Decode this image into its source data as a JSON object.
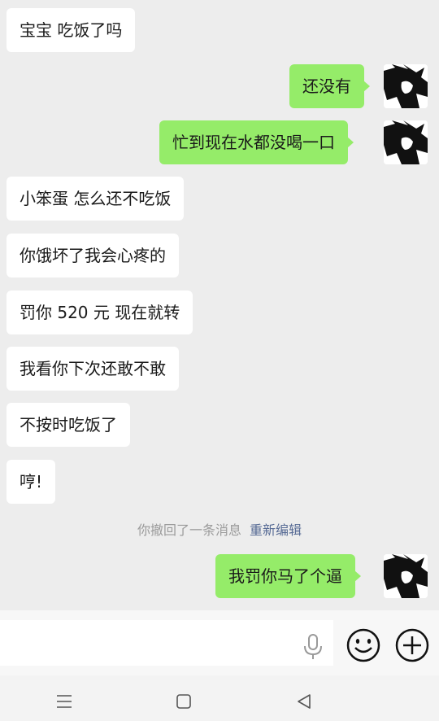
{
  "messages": [
    {
      "side": "left",
      "text": "宝宝  吃饭了吗"
    },
    {
      "side": "right",
      "text": "还没有"
    },
    {
      "side": "right",
      "text": "忙到现在水都没喝一口"
    },
    {
      "side": "left",
      "text": "小笨蛋  怎么还不吃饭"
    },
    {
      "side": "left",
      "text": "你饿坏了我会心疼的"
    },
    {
      "side": "left",
      "text": "罚你 520 元  现在就转"
    },
    {
      "side": "left",
      "text": "我看你下次还敢不敢"
    },
    {
      "side": "left",
      "text": "不按时吃饭了"
    },
    {
      "side": "left",
      "text": "哼!"
    },
    {
      "side": "right",
      "text": "我罚你马了个逼"
    }
  ],
  "recall_notice": {
    "text": "你撤回了一条消息",
    "action": "重新编辑"
  },
  "input_bar": {
    "value": "",
    "icons": [
      "microphone-icon",
      "emoji-icon",
      "plus-icon"
    ]
  },
  "nav_bar": {
    "icons": [
      "menu-icon",
      "home-icon",
      "back-icon"
    ]
  },
  "colors": {
    "background": "#ededed",
    "own_bubble": "#95ec69",
    "other_bubble": "#ffffff",
    "link": "#576b95"
  }
}
